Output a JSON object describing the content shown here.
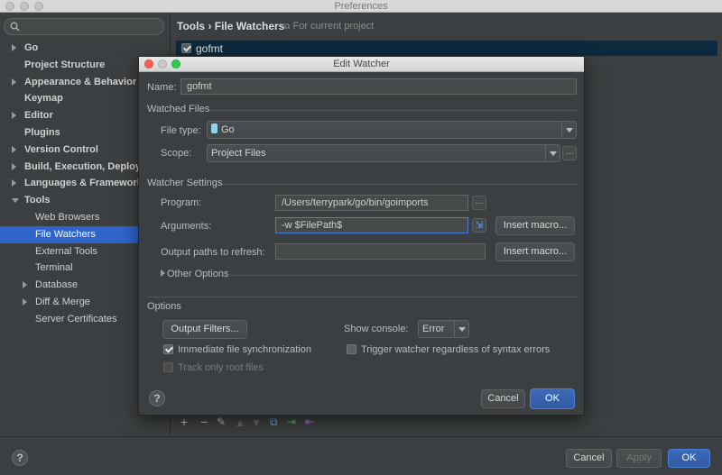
{
  "window": {
    "title": "Preferences"
  },
  "sidebar": {
    "search_placeholder": "",
    "items": [
      {
        "label": "Go",
        "arrow": "right"
      },
      {
        "label": "Project Structure",
        "arrow": ""
      },
      {
        "label": "Appearance & Behavior",
        "arrow": "right"
      },
      {
        "label": "Keymap",
        "arrow": ""
      },
      {
        "label": "Editor",
        "arrow": "right"
      },
      {
        "label": "Plugins",
        "arrow": ""
      },
      {
        "label": "Version Control",
        "arrow": "right"
      },
      {
        "label": "Build, Execution, Deploy",
        "arrow": "right"
      },
      {
        "label": "Languages & Framework",
        "arrow": "right"
      },
      {
        "label": "Tools",
        "arrow": "down"
      },
      {
        "label": "Web Browsers",
        "arrow": ""
      },
      {
        "label": "File Watchers",
        "arrow": ""
      },
      {
        "label": "External Tools",
        "arrow": ""
      },
      {
        "label": "Terminal",
        "arrow": ""
      },
      {
        "label": "Database",
        "arrow": "right"
      },
      {
        "label": "Diff & Merge",
        "arrow": "right"
      },
      {
        "label": "Server Certificates",
        "arrow": ""
      }
    ]
  },
  "content": {
    "breadcrumb": "Tools › File Watchers",
    "scope_note": "For current project",
    "watchers": [
      {
        "name": "gofmt",
        "enabled": true
      }
    ]
  },
  "dialog": {
    "title": "Edit Watcher",
    "name_label": "Name:",
    "name_value": "gofmt",
    "watched_files_label": "Watched Files",
    "file_type_label": "File type:",
    "file_type_value": "Go",
    "scope_label": "Scope:",
    "scope_value": "Project Files",
    "watcher_settings_label": "Watcher Settings",
    "program_label": "Program:",
    "program_value": "/Users/terrypark/go/bin/goimports",
    "arguments_label": "Arguments:",
    "arguments_value": "-w $FilePath$",
    "output_paths_label": "Output paths to refresh:",
    "output_paths_value": "",
    "insert_macro_label": "Insert macro...",
    "other_options_label": "Other Options",
    "options_label": "Options",
    "output_filters_label": "Output Filters...",
    "show_console_label": "Show console:",
    "show_console_value": "Error",
    "immediate_sync_label": "Immediate file synchronization",
    "immediate_sync_checked": true,
    "trigger_regardless_label": "Trigger watcher regardless of syntax errors",
    "trigger_regardless_checked": false,
    "track_root_label": "Track only root files",
    "track_root_checked": false,
    "cancel_label": "Cancel",
    "ok_label": "OK"
  },
  "footer": {
    "cancel_label": "Cancel",
    "apply_label": "Apply",
    "ok_label": "OK"
  },
  "colors": {
    "accent": "#2f65ca",
    "selected_row": "#0d293e",
    "background": "#3c3f41"
  }
}
